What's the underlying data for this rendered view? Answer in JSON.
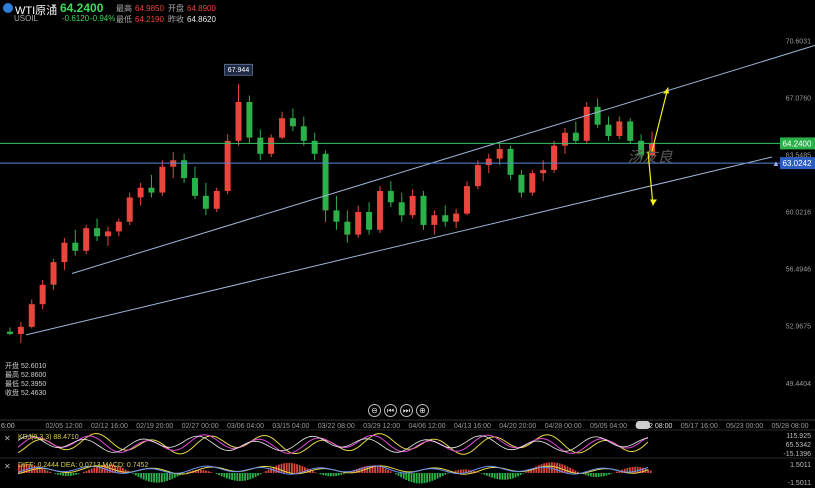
{
  "header": {
    "symbol_name": "WTI原油",
    "last_price": "64.2400",
    "code": "USOIL",
    "change": "-0.6120",
    "change_pct": "-0.94%",
    "high_label": "最高",
    "high_value": "64.9850",
    "open_label": "开盘",
    "open_value": "64.8900",
    "low_label": "最低",
    "low_value": "64.2190",
    "prev_label": "昨收",
    "prev_value": "64.8620"
  },
  "ohlc_box": {
    "open_label": "开盘",
    "open_value": "52.6010",
    "high_label": "最高",
    "high_value": "52.8600",
    "low_label": "最低",
    "low_value": "52.3950",
    "close_label": "收盘",
    "close_value": "52.4630"
  },
  "watermark": "汤友良",
  "controls": [
    "⊖",
    "⏮",
    "⏭",
    "⊕"
  ],
  "indicators": {
    "kdj_label": "KDJ(9,3,3)  88.4710",
    "macd_label": "DIFF: 0.2444  DEA: 0.0713  MACD: 0.7452",
    "kdj_axis": [
      "115.925",
      "65.5342",
      "-15.1396"
    ],
    "macd_axis": [
      "1.5011",
      "-1.5011"
    ]
  },
  "colors": {
    "up": "#e8453c",
    "down": "#2bb14a",
    "channel": "#9fb6d6",
    "green_line": "#36c26a",
    "blue_line": "#5a88d8",
    "arrow": "#f5f01a",
    "price_tag": "#2bb14a",
    "prev_tag": "#2a5fc0"
  },
  "chart_data": {
    "type": "candlestick",
    "symbol": "WTI原油",
    "y_ticks": [
      "70.6031",
      "67.0760",
      "63.5485",
      "60.0216",
      "56.4946",
      "52.9675",
      "49.4404"
    ],
    "ylim": [
      48.5,
      71.5
    ],
    "x_ticks": [
      "02/05 12:00",
      "02/12 16:00",
      "02/19 20:00",
      "02/27 00:00",
      "03/06 04:00",
      "03/15 04:00",
      "03/22 08:00",
      "03/29 12:00",
      "04/06 12:00",
      "04/13 16:00",
      "04/20 20:00",
      "04/28 00:00",
      "05/05 04:00",
      "05/12 08:00",
      "05/17 16:00",
      "05/23 00:00",
      "05/28 08:00"
    ],
    "x_tick_left_clip": "6:00",
    "current_price": "64.2400",
    "prev_line_price": "63.0242",
    "peak_annotation": "67.944",
    "series": [
      {
        "values": [
          [
            52.6,
            52.86,
            52.39,
            52.46
          ],
          [
            52.46,
            53.2,
            51.9,
            52.9
          ],
          [
            52.9,
            54.6,
            52.8,
            54.3
          ],
          [
            54.3,
            55.8,
            54.0,
            55.5
          ],
          [
            55.5,
            57.1,
            55.2,
            56.9
          ],
          [
            56.9,
            58.4,
            56.4,
            58.1
          ],
          [
            58.1,
            58.9,
            57.3,
            57.6
          ],
          [
            57.6,
            59.2,
            57.4,
            59.0
          ],
          [
            59.0,
            59.6,
            58.2,
            58.5
          ],
          [
            58.5,
            59.1,
            57.9,
            58.8
          ],
          [
            58.8,
            59.6,
            58.5,
            59.4
          ],
          [
            59.4,
            61.2,
            59.2,
            60.9
          ],
          [
            60.9,
            61.8,
            60.4,
            61.5
          ],
          [
            61.5,
            62.3,
            60.9,
            61.2
          ],
          [
            61.2,
            63.2,
            61.0,
            62.8
          ],
          [
            62.8,
            63.7,
            62.1,
            63.2
          ],
          [
            63.2,
            63.6,
            61.8,
            62.1
          ],
          [
            62.1,
            62.8,
            60.8,
            61.0
          ],
          [
            61.0,
            61.8,
            59.8,
            60.2
          ],
          [
            60.2,
            61.5,
            60.0,
            61.3
          ],
          [
            61.3,
            64.8,
            61.1,
            64.4
          ],
          [
            64.4,
            67.9,
            64.1,
            66.8
          ],
          [
            66.8,
            67.2,
            64.2,
            64.6
          ],
          [
            64.6,
            65.1,
            63.2,
            63.6
          ],
          [
            63.6,
            64.8,
            63.4,
            64.6
          ],
          [
            64.6,
            66.2,
            64.5,
            65.8
          ],
          [
            65.8,
            66.4,
            65.0,
            65.3
          ],
          [
            65.3,
            65.9,
            64.1,
            64.4
          ],
          [
            64.4,
            64.9,
            63.2,
            63.6
          ],
          [
            63.6,
            63.8,
            59.4,
            60.1
          ],
          [
            60.1,
            61.0,
            58.9,
            59.4
          ],
          [
            59.4,
            60.1,
            58.1,
            58.6
          ],
          [
            58.6,
            60.4,
            58.4,
            60.0
          ],
          [
            60.0,
            60.6,
            58.6,
            58.9
          ],
          [
            58.9,
            61.6,
            58.7,
            61.3
          ],
          [
            61.3,
            61.9,
            60.3,
            60.6
          ],
          [
            60.6,
            61.2,
            59.4,
            59.8
          ],
          [
            59.8,
            61.4,
            59.6,
            61.0
          ],
          [
            61.0,
            61.3,
            58.9,
            59.2
          ],
          [
            59.2,
            60.1,
            58.6,
            59.8
          ],
          [
            59.8,
            60.4,
            59.1,
            59.4
          ],
          [
            59.4,
            60.2,
            59.0,
            59.9
          ],
          [
            59.9,
            61.9,
            59.8,
            61.6
          ],
          [
            61.6,
            63.2,
            61.4,
            62.9
          ],
          [
            62.9,
            63.6,
            62.4,
            63.3
          ],
          [
            63.3,
            64.2,
            62.9,
            63.9
          ],
          [
            63.9,
            64.1,
            62.0,
            62.3
          ],
          [
            62.3,
            62.6,
            60.9,
            61.2
          ],
          [
            61.2,
            62.6,
            61.0,
            62.4
          ],
          [
            62.4,
            63.2,
            61.9,
            62.6
          ],
          [
            62.6,
            64.4,
            62.4,
            64.1
          ],
          [
            64.1,
            65.2,
            63.6,
            64.9
          ],
          [
            64.9,
            65.6,
            64.2,
            64.4
          ],
          [
            64.4,
            66.8,
            64.2,
            66.5
          ],
          [
            66.5,
            67.0,
            65.2,
            65.4
          ],
          [
            65.4,
            65.9,
            64.4,
            64.7
          ],
          [
            64.7,
            65.9,
            64.5,
            65.6
          ],
          [
            65.6,
            65.8,
            64.2,
            64.4
          ],
          [
            64.4,
            64.8,
            63.2,
            63.5
          ],
          [
            63.5,
            64.98,
            63.3,
            64.24
          ]
        ]
      }
    ],
    "channel_lines": [
      {
        "from": [
          "start",
          56.2
        ],
        "to": [
          "end",
          70.3
        ]
      },
      {
        "from": [
          "start",
          52.4
        ],
        "to": [
          "end",
          63.4
        ]
      }
    ],
    "annotations": [
      "arrow up from last bar",
      "arrow down from last bar"
    ]
  }
}
